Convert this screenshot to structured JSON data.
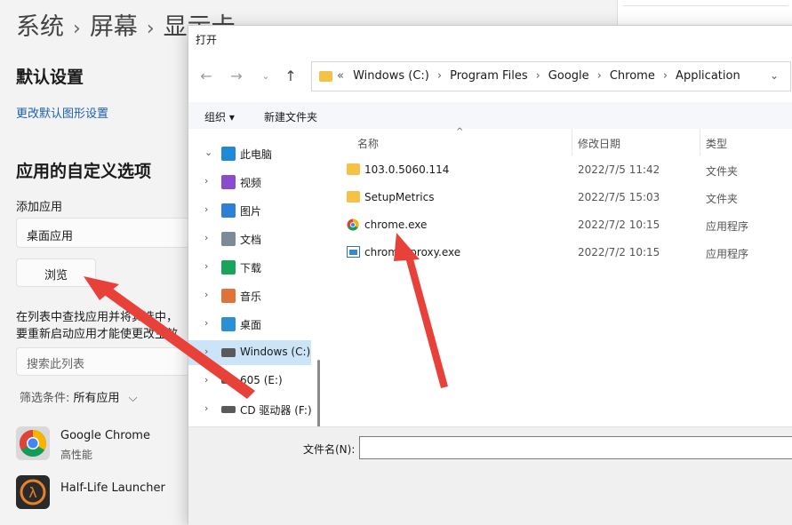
{
  "settings": {
    "breadcrumb": [
      "系统",
      "屏幕",
      "显示卡"
    ],
    "default_settings_title": "默认设置",
    "change_default_graphics_link": "更改默认图形设置",
    "custom_options_title": "应用的自定义选项",
    "add_app_label": "添加应用",
    "app_type_value": "桌面应用",
    "browse_button": "浏览",
    "desc_line1": "在列表中查找应用并将其选中，",
    "desc_line2": "要重新启动应用才能使更改生效",
    "search_placeholder": "搜索此列表",
    "filter_label": "筛选条件: ",
    "filter_value": "所有应用",
    "apps": [
      {
        "name": "Google Chrome",
        "status": "高性能"
      },
      {
        "name": "Half-Life Launcher",
        "status": ""
      }
    ]
  },
  "dialog": {
    "title": "打开",
    "address": {
      "prefix": "«",
      "crumbs": [
        "Windows (C:)",
        "Program Files",
        "Google",
        "Chrome",
        "Application"
      ]
    },
    "toolbar": {
      "organize": "组织 ▾",
      "new_folder": "新建文件夹"
    },
    "nav": [
      {
        "label": "此电脑",
        "expanded": true,
        "icon": "monitor-icon",
        "color": "#1f8ad8"
      },
      {
        "label": "视频",
        "icon": "video-icon",
        "color": "#8a4ccf"
      },
      {
        "label": "图片",
        "icon": "pictures-icon",
        "color": "#2f7fd8"
      },
      {
        "label": "文档",
        "icon": "documents-icon",
        "color": "#7c8a99"
      },
      {
        "label": "下载",
        "icon": "download-icon",
        "color": "#1aa35a"
      },
      {
        "label": "音乐",
        "icon": "music-icon",
        "color": "#e0733a"
      },
      {
        "label": "桌面",
        "icon": "desktop-icon",
        "color": "#2b8fd6"
      },
      {
        "label": "Windows (C:)",
        "icon": "drive-icon",
        "color": "#5a5a5a",
        "selected": true
      },
      {
        "label": "605 (E:)",
        "icon": "drive-icon",
        "color": "#5a5a5a"
      },
      {
        "label": "CD 驱动器 (F:)",
        "icon": "cd-drive-icon",
        "color": "#5a5a5a"
      }
    ],
    "columns": {
      "name": "名称",
      "date": "修改日期",
      "type": "类型"
    },
    "files": [
      {
        "name": "103.0.5060.114",
        "date": "2022/7/5 11:42",
        "type": "文件夹",
        "kind": "folder"
      },
      {
        "name": "SetupMetrics",
        "date": "2022/7/5 15:03",
        "type": "文件夹",
        "kind": "folder"
      },
      {
        "name": "chrome.exe",
        "date": "2022/7/2 10:15",
        "type": "应用程序",
        "kind": "chrome"
      },
      {
        "name": "chrome_proxy.exe",
        "date": "2022/7/2 10:15",
        "type": "应用程序",
        "kind": "exe"
      }
    ],
    "filename_label": "文件名(N):",
    "filename_value": ""
  },
  "colors": {
    "accent": "#1a5fb4",
    "selection": "#cce4f7",
    "arrow": "#e8413a"
  }
}
